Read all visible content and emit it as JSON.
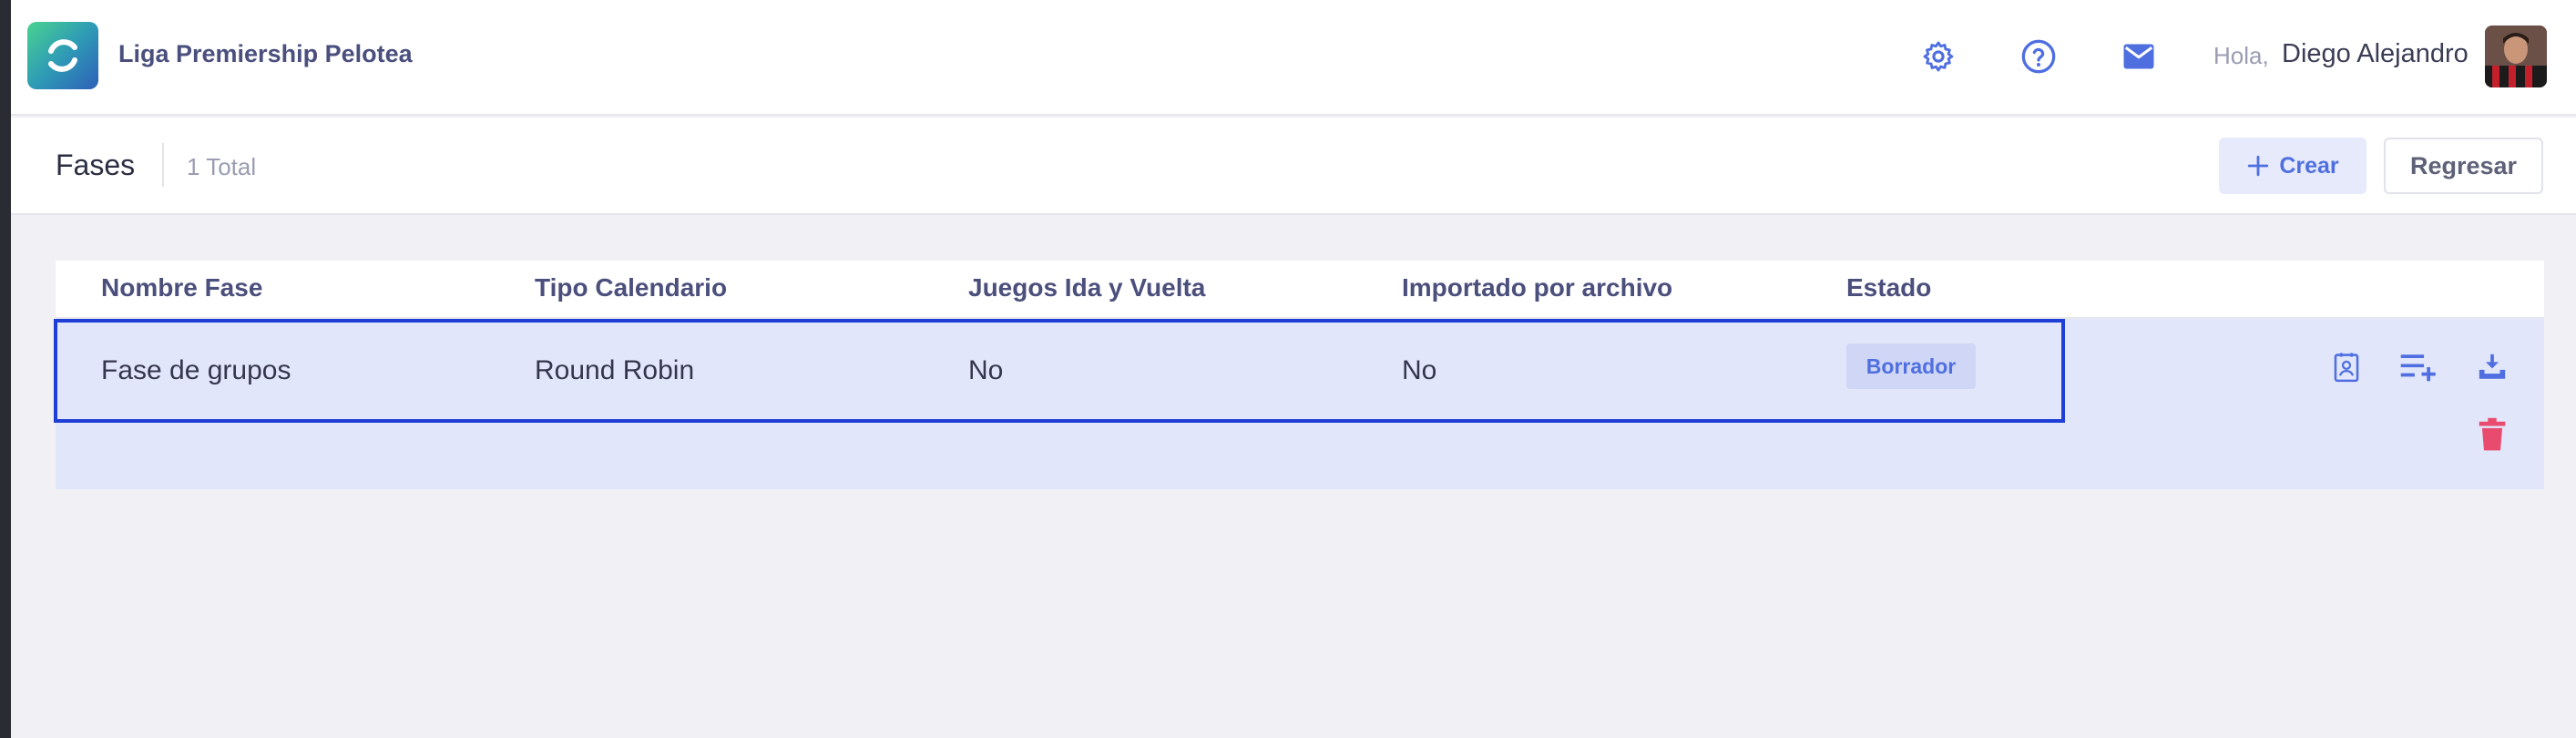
{
  "header": {
    "brand": "Liga Premiership Pelotea",
    "greeting": "Hola,",
    "user_name": "Diego Alejandro",
    "icons": [
      "gear-icon",
      "help-circle-icon",
      "mail-icon"
    ]
  },
  "page": {
    "title": "Fases",
    "total": "1 Total",
    "create_label": "Crear",
    "back_label": "Regresar"
  },
  "table": {
    "columns": [
      "Nombre Fase",
      "Tipo Calendario",
      "Juegos Ida y Vuelta",
      "Importado por archivo",
      "Estado"
    ],
    "rows": [
      {
        "nombre": "Fase de grupos",
        "tipo": "Round Robin",
        "ida_vuelta": "No",
        "importado": "No",
        "estado": "Borrador",
        "actions": [
          "contact-card-icon",
          "playlist-add-icon",
          "download-icon",
          "trash-icon"
        ]
      }
    ]
  },
  "colors": {
    "accent": "#4f6fe0",
    "selection_border": "#1f3ed6",
    "row_bg": "#e2e6fb",
    "danger": "#e94b6e"
  }
}
